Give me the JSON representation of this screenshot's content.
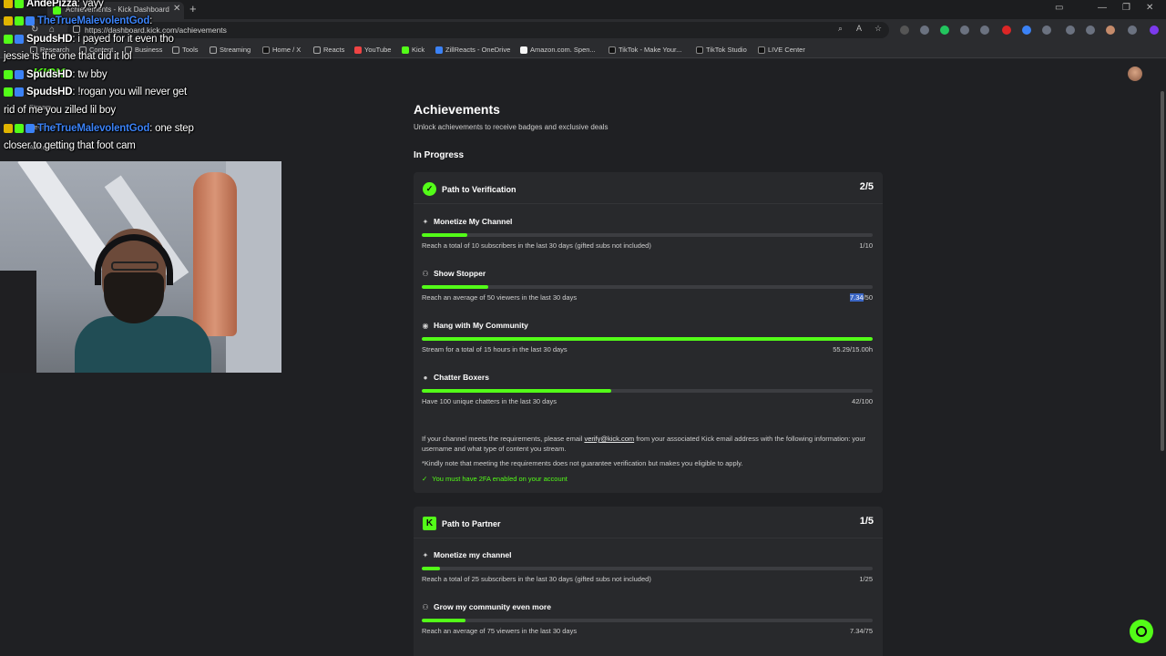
{
  "browser": {
    "tab_title": "Achievements - Kick Dashboard",
    "url": "https://dashboard.kick.com/achievements",
    "bookmarks": [
      {
        "label": "Research",
        "icon": "folder-icon"
      },
      {
        "label": "Content",
        "icon": "folder-icon"
      },
      {
        "label": "Business",
        "icon": "folder-icon"
      },
      {
        "label": "Tools",
        "icon": "folder-icon"
      },
      {
        "label": "Streaming",
        "icon": "folder-icon"
      },
      {
        "label": "Home / X",
        "icon": "x-logo-icon"
      },
      {
        "label": "Reacts",
        "icon": "folder-icon"
      },
      {
        "label": "YouTube",
        "icon": "youtube-icon"
      },
      {
        "label": "Kick",
        "icon": "kick-icon"
      },
      {
        "label": "ZillReacts - OneDrive",
        "icon": "onedrive-icon"
      },
      {
        "label": "Amazon.com. Spen...",
        "icon": "amazon-icon"
      },
      {
        "label": "TikTok - Make Your...",
        "icon": "tiktok-icon"
      },
      {
        "label": "TikTok Studio",
        "icon": "tiktok-icon"
      },
      {
        "label": "LIVE Center",
        "icon": "tiktok-icon"
      }
    ]
  },
  "sidebar_ghost": {
    "stream": "Stream",
    "revenue": "Revenue",
    "achievements": "Achievements"
  },
  "chat": {
    "logo": "KICK",
    "messages": [
      {
        "user": "AndePizza",
        "text": ": yayy"
      },
      {
        "user": "TheTrueMalevolentGod",
        "text": ":",
        "color": "#3b82f6"
      },
      {
        "user": "SpudsHD",
        "text": ": i payed for it even tho"
      },
      {
        "user": "",
        "text": "jessie is the one that did it lol"
      },
      {
        "user": "SpudsHD",
        "text": ": tw bby"
      },
      {
        "user": "SpudsHD",
        "text": ": !rogan you will never get"
      },
      {
        "user": "",
        "text": "rid of me you zilled lil boy"
      },
      {
        "user": "TheTrueMalevolentGod",
        "text": ": one step",
        "color": "#3b82f6"
      },
      {
        "user": "",
        "text": "closer to getting that foot cam"
      }
    ]
  },
  "page": {
    "title": "Achievements",
    "subtitle": "Unlock achievements to receive badges and exclusive deals",
    "section": "In Progress"
  },
  "verification": {
    "title": "Path to Verification",
    "count": "2/5",
    "items": [
      {
        "icon": "sparkle-icon",
        "name": "Monetize My Channel",
        "desc": "Reach a total of 10 subscribers in the last 30 days (gifted subs not included)",
        "progress_pre": "",
        "progress_hl": "",
        "progress": "1/10",
        "fraction": 0.1
      },
      {
        "icon": "users-icon",
        "name": "Show Stopper",
        "desc": "Reach an average of 50 viewers in the last 30 days",
        "progress_pre": "",
        "progress_hl": "7.34",
        "progress": "/50",
        "fraction": 0.1468
      },
      {
        "icon": "broadcast-icon",
        "name": "Hang with My Community",
        "desc": "Stream for a total of 15 hours in the last 30 days",
        "progress_pre": "",
        "progress_hl": "",
        "progress": "55.29/15.00h",
        "fraction": 1.0
      },
      {
        "icon": "chat-bubble-icon",
        "name": "Chatter Boxers",
        "desc": "Have 100 unique chatters in the last 30 days",
        "progress_pre": "",
        "progress_hl": "",
        "progress": "42/100",
        "fraction": 0.42
      }
    ],
    "note_pre": "If your channel meets the requirements, please email ",
    "note_email": "verify@kick.com",
    "note_post": " from your associated Kick email address with the following information: your username and what type of content you stream.",
    "disclaimer": "*Kindly note that meeting the requirements does not guarantee verification but makes you eligible to apply.",
    "requirement": "You must have 2FA enabled on your account"
  },
  "partner": {
    "title": "Path to Partner",
    "count": "1/5",
    "items": [
      {
        "icon": "sparkle-icon",
        "name": "Monetize my channel",
        "desc": "Reach a total of 25 subscribers in the last 30 days (gifted subs not included)",
        "progress": "1/25",
        "fraction": 0.04
      },
      {
        "icon": "users-icon",
        "name": "Grow my community even more",
        "desc": "Reach an average of 75 viewers in the last 30 days",
        "progress": "7.34/75",
        "fraction": 0.0979
      }
    ]
  },
  "colors": {
    "accent": "#53fc18",
    "background": "#1f2023",
    "card": "#28292c"
  }
}
